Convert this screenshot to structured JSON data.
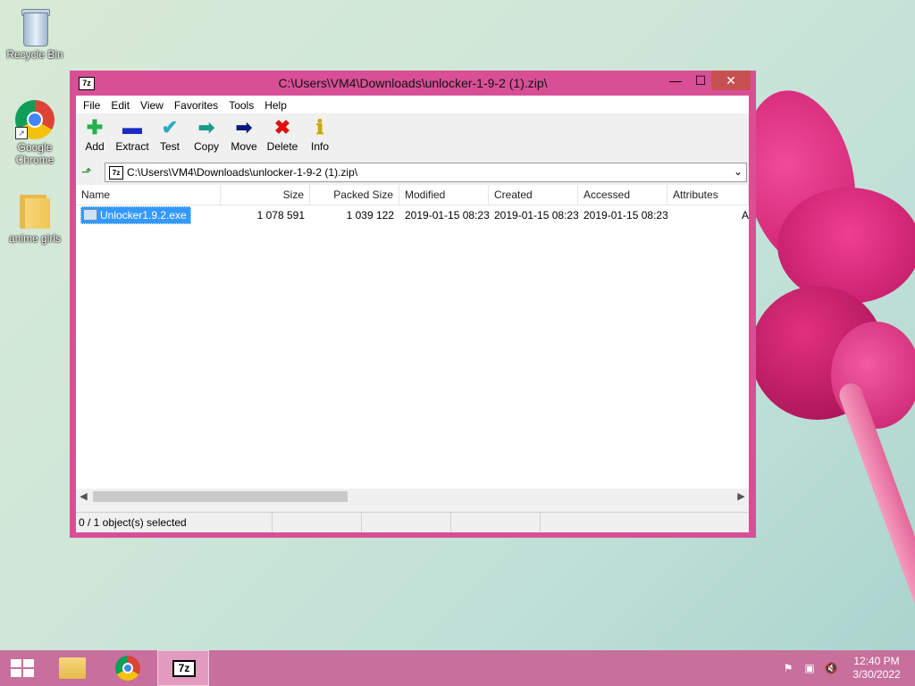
{
  "desktop": {
    "icons": [
      {
        "label": "Recycle Bin"
      },
      {
        "label": "Google Chrome"
      },
      {
        "label": "anime girls"
      }
    ]
  },
  "window": {
    "title": "C:\\Users\\VM4\\Downloads\\unlocker-1-9-2 (1).zip\\",
    "app_icon_text": "7z",
    "controls": {
      "minimize": "—",
      "maximize": "☐",
      "close": "✕"
    }
  },
  "menu": [
    "File",
    "Edit",
    "View",
    "Favorites",
    "Tools",
    "Help"
  ],
  "toolbar": [
    {
      "label": "Add",
      "glyph": "✚",
      "color": "#22b14c"
    },
    {
      "label": "Extract",
      "glyph": "▬",
      "color": "#1a2bbf"
    },
    {
      "label": "Test",
      "glyph": "✔",
      "color": "#2fa8c4"
    },
    {
      "label": "Copy",
      "glyph": "➡",
      "color": "#1a9a8a"
    },
    {
      "label": "Move",
      "glyph": "➡",
      "color": "#0a1a7a"
    },
    {
      "label": "Delete",
      "glyph": "✖",
      "color": "#e01010"
    },
    {
      "label": "Info",
      "glyph": "ℹ",
      "color": "#c9a800"
    }
  ],
  "address": {
    "path": "C:\\Users\\VM4\\Downloads\\unlocker-1-9-2 (1).zip\\",
    "icon_text": "7z"
  },
  "columns": [
    "Name",
    "Size",
    "Packed Size",
    "Modified",
    "Created",
    "Accessed",
    "Attributes"
  ],
  "rows": [
    {
      "name": "Unlocker1.9.2.exe",
      "size": "1 078 591",
      "packed": "1 039 122",
      "modified": "2019-01-15 08:23",
      "created": "2019-01-15 08:23",
      "accessed": "2019-01-15 08:23",
      "attributes": "A"
    }
  ],
  "status": {
    "selection": "0 / 1 object(s) selected"
  },
  "taskbar": {
    "active_app_text": "7z",
    "clock_time": "12:40 PM",
    "clock_date": "3/30/2022"
  },
  "colors": {
    "window_frame": "#d94f96",
    "taskbar": "#c76f9d",
    "selection": "#3399ff",
    "close_button": "#c75050"
  }
}
